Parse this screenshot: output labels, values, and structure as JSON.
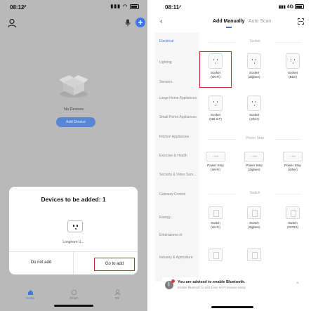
{
  "left_phone": {
    "status_time": "08:12",
    "status_location_arrow": "location-arrow-icon",
    "empty_state_text": "No Devices",
    "add_device_label": "Add Device",
    "dialog": {
      "title": "Devices to be added: 1",
      "device_name": "Longhorn U...",
      "do_not_add_label": "Do not add",
      "go_to_add_label": "Go to add"
    },
    "tabs": [
      {
        "label": "Home"
      },
      {
        "label": "Smart"
      },
      {
        "label": "Me"
      }
    ],
    "colors": {
      "accent": "#3d76e8",
      "highlight": "#d8262b"
    }
  },
  "right_phone": {
    "status_time": "08:11",
    "network": "4G",
    "header": {
      "tab_manual": "Add Manually",
      "tab_scan": "Auto Scan"
    },
    "categories": [
      "Electrical",
      "Lighting",
      "Sensors",
      "Large Home Appliances",
      "Small Home Appliances",
      "Kitchen Appliances",
      "Exercise & Health",
      "Security & Video Surv...",
      "Gateway Control",
      "Energy",
      "Entertainme nt",
      "Industry & Agriculture"
    ],
    "sections": {
      "socket": {
        "title": "Socket",
        "items": [
          {
            "name": "Socket",
            "sub": "(Wi-Fi)"
          },
          {
            "name": "Socket",
            "sub": "(Zigbee)"
          },
          {
            "name": "Socket",
            "sub": "(BLE)"
          },
          {
            "name": "Socket",
            "sub": "(NB-IoT)"
          },
          {
            "name": "Socket",
            "sub": "(other)"
          }
        ]
      },
      "power_strip": {
        "title": "Power Strip",
        "items": [
          {
            "name": "Power Strip",
            "sub": "(Wi-Fi)"
          },
          {
            "name": "Power Strip",
            "sub": "(Zigbee)"
          },
          {
            "name": "Power Strip",
            "sub": "(other)"
          }
        ]
      },
      "switch": {
        "title": "Switch",
        "items": [
          {
            "name": "Switch",
            "sub": "(Wi-Fi)"
          },
          {
            "name": "Switch",
            "sub": "(Zigbee)"
          },
          {
            "name": "Switch",
            "sub": "(GPRS)"
          }
        ]
      }
    },
    "bluetooth_banner": {
      "title": "You are advised to enable Bluetooth.",
      "subtitle": "Enable Bluetooth to add some Wi-Fi devices easily."
    }
  }
}
